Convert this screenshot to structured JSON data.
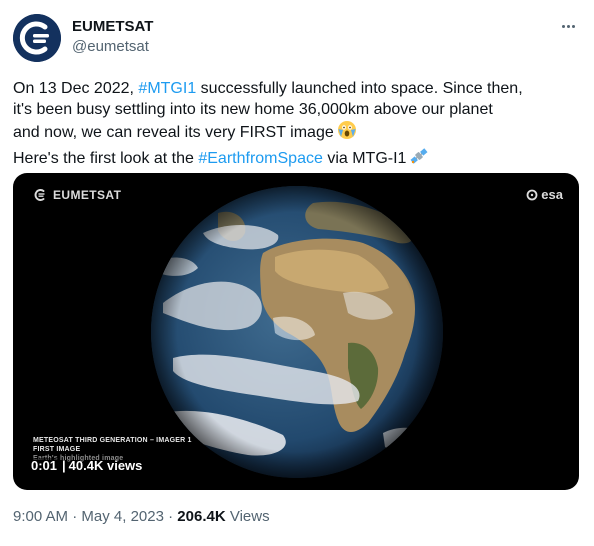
{
  "author": {
    "display_name": "EUMETSAT",
    "handle": "@eumetsat",
    "avatar_icon": "eumetsat-logo-icon",
    "brand_color": "#13315e"
  },
  "more_icon": "more-options-icon",
  "tweet": {
    "line1": {
      "a": "On 13 Dec 2022, ",
      "tag": "#MTGI1",
      "b": " successfully launched into space. Since then,"
    },
    "line2": "it's been busy settling into its new home 36,000km above our planet",
    "line3": {
      "a": "and now, we can reveal its very FIRST image",
      "emoji": "screaming-face-emoji"
    },
    "line4": {
      "a": "Here's the first look at the ",
      "tag": "#EarthfromSpace",
      "b": " via MTG-I1",
      "emoji": "satellite-emoji"
    },
    "hashtag_color": "#1d9bf0"
  },
  "media": {
    "brand": "EUMETSAT",
    "esa": "esa",
    "caption_line1": "METEOSAT THIRD GENERATION – IMAGER 1",
    "caption_line2": "FIRST IMAGE",
    "caption_line3": "Earth's highlighted image",
    "timestamp": "0:01",
    "views_separator": "|",
    "views": "40.4K views"
  },
  "meta": {
    "time": "9:00 AM",
    "dot1": "·",
    "date": "May 4, 2023",
    "dot2": "·",
    "views_count": "206.4K",
    "views_label": "Views"
  }
}
